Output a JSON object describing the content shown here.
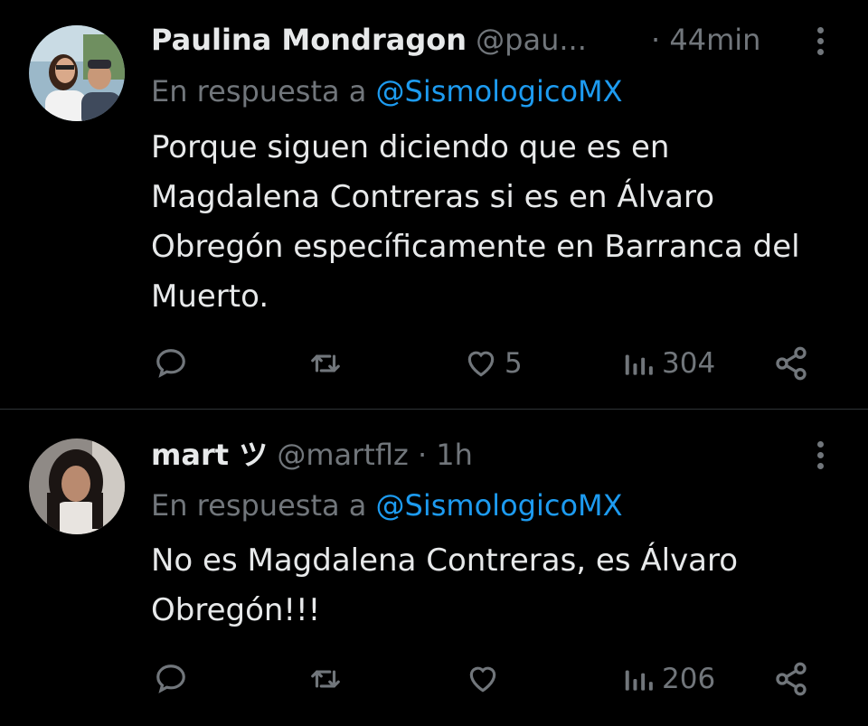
{
  "tweets": [
    {
      "name": "Paulina Mondragon",
      "handle": "@pau...",
      "time": "· 44min",
      "reply_prefix": "En respuesta a",
      "reply_to": "@SismologicoMX",
      "text": "Porque siguen diciendo que es en Magdalena Contreras si es en Álvaro Obregón específicamente en Barranca del Muerto.",
      "likes": "5",
      "views": "304"
    },
    {
      "name": "mart ツ",
      "handle": "@martflz",
      "time": "· 1h",
      "reply_prefix": "En respuesta a",
      "reply_to": "@SismologicoMX",
      "text": "No es Magdalena Contreras, es Álvaro Obregón!!!",
      "likes": "",
      "views": "206"
    }
  ],
  "icons": {
    "reply": "reply-icon",
    "retweet": "retweet-icon",
    "like": "heart-icon",
    "views": "views-icon",
    "share": "share-icon",
    "more": "more-options-icon"
  },
  "colors": {
    "background": "#000000",
    "text": "#e7e9ea",
    "secondary": "#71767b",
    "link": "#1d9bf0",
    "divider": "#2f3336"
  }
}
